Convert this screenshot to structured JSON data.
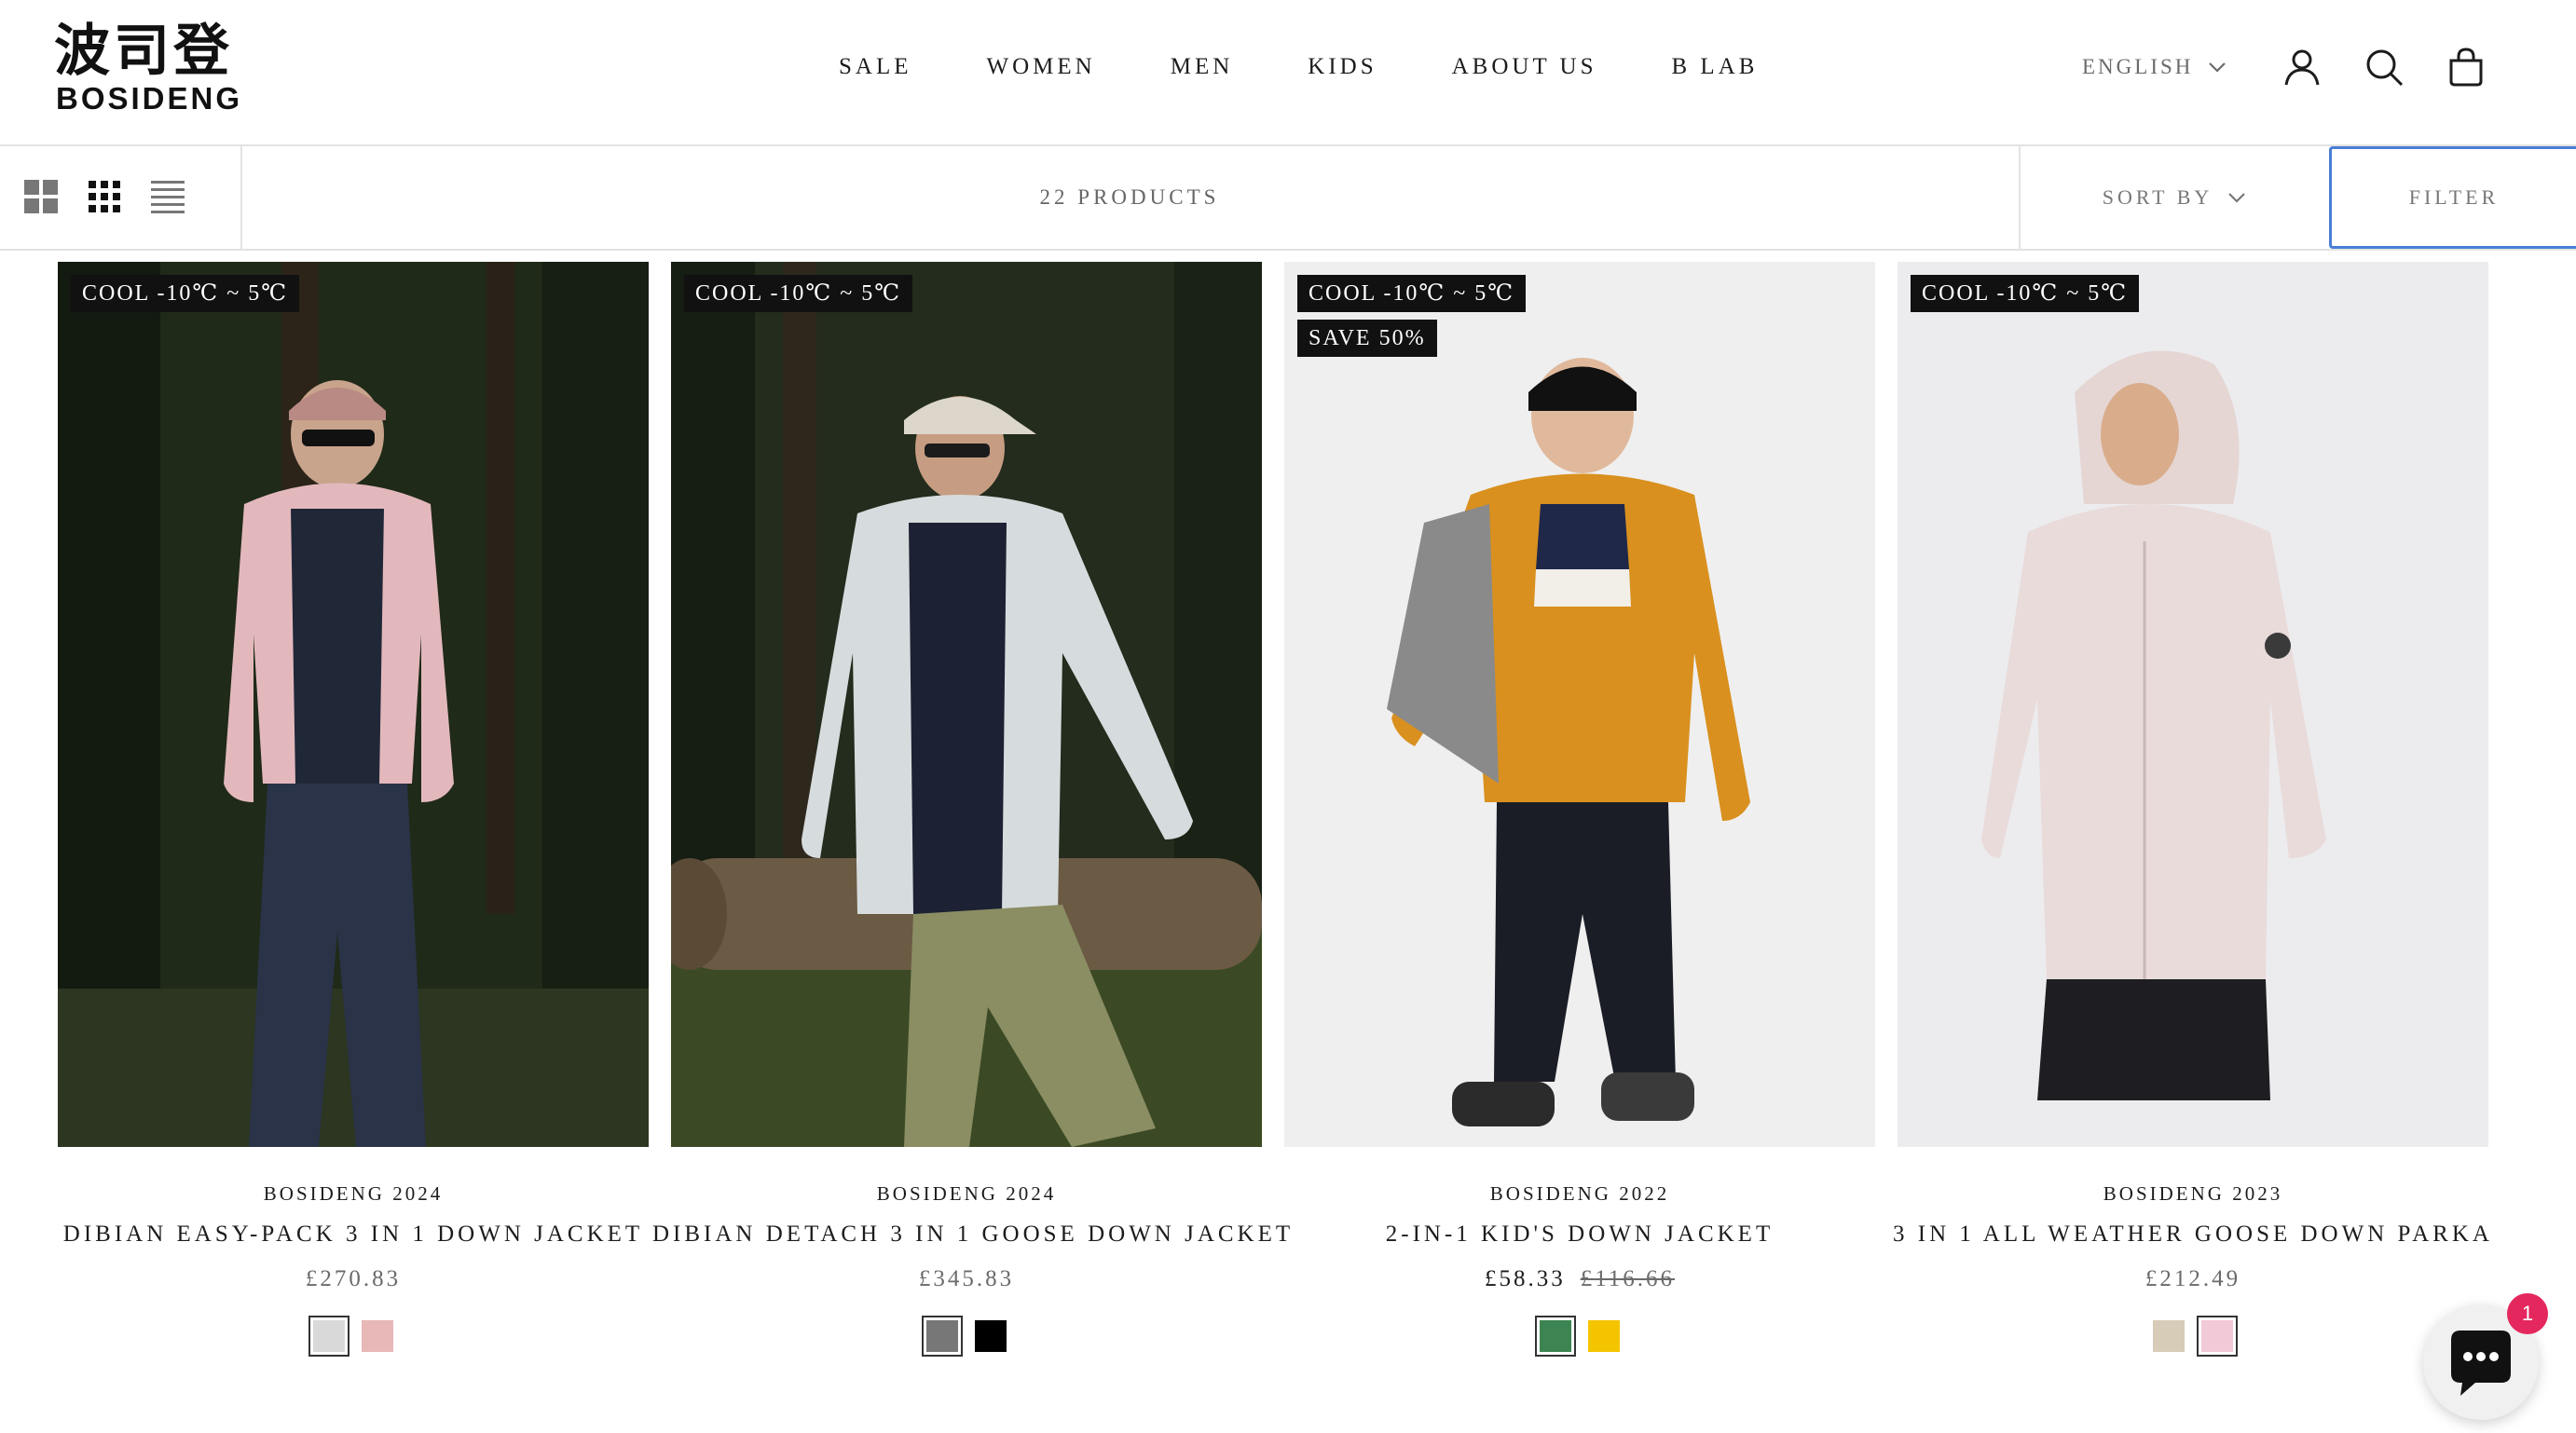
{
  "brand": {
    "logo_cn": "波司登",
    "logo_en": "BOSIDENG"
  },
  "nav": [
    {
      "label": "SALE"
    },
    {
      "label": "WOMEN"
    },
    {
      "label": "MEN"
    },
    {
      "label": "KIDS"
    },
    {
      "label": "ABOUT US"
    },
    {
      "label": "B LAB"
    }
  ],
  "header": {
    "language": "ENGLISH",
    "icons": [
      "account-icon",
      "search-icon",
      "cart-icon"
    ]
  },
  "toolbar": {
    "view_modes": [
      "grid-large-icon",
      "grid-small-icon",
      "list-icon"
    ],
    "product_count": "22 PRODUCTS",
    "sort_label": "SORT BY",
    "filter_label": "FILTER"
  },
  "products": [
    {
      "badges": [
        "COOL -10℃ ~ 5℃"
      ],
      "brand": "BOSIDENG 2024",
      "title": "DIBIAN EASY-PACK 3 IN 1 DOWN JACKET",
      "price": "£270.83",
      "original_price": "",
      "swatches": [
        "#d9d9d9",
        "#e8b7b7"
      ],
      "selected_swatch": 0
    },
    {
      "badges": [
        "COOL -10℃ ~ 5℃"
      ],
      "brand": "BOSIDENG 2024",
      "title": "DIBIAN DETACH 3 IN 1 GOOSE DOWN JACKET",
      "price": "£345.83",
      "original_price": "",
      "swatches": [
        "#777777",
        "#000000"
      ],
      "selected_swatch": 0
    },
    {
      "badges": [
        "COOL -10℃ ~ 5℃",
        "SAVE 50%"
      ],
      "brand": "BOSIDENG 2022",
      "title": "2-IN-1 KID'S DOWN JACKET",
      "price": "£58.33",
      "original_price": "£116.66",
      "swatches": [
        "#3c8451",
        "#f5c400"
      ],
      "selected_swatch": 0
    },
    {
      "badges": [
        "COOL -10℃ ~ 5℃"
      ],
      "brand": "BOSIDENG 2023",
      "title": "3 IN 1 ALL WEATHER GOOSE DOWN PARKA",
      "price": "£212.49",
      "original_price": "",
      "swatches": [
        "#d7ccb8",
        "#f2c9d6"
      ],
      "selected_swatch": 1
    }
  ],
  "chat": {
    "unread_count": "1"
  }
}
